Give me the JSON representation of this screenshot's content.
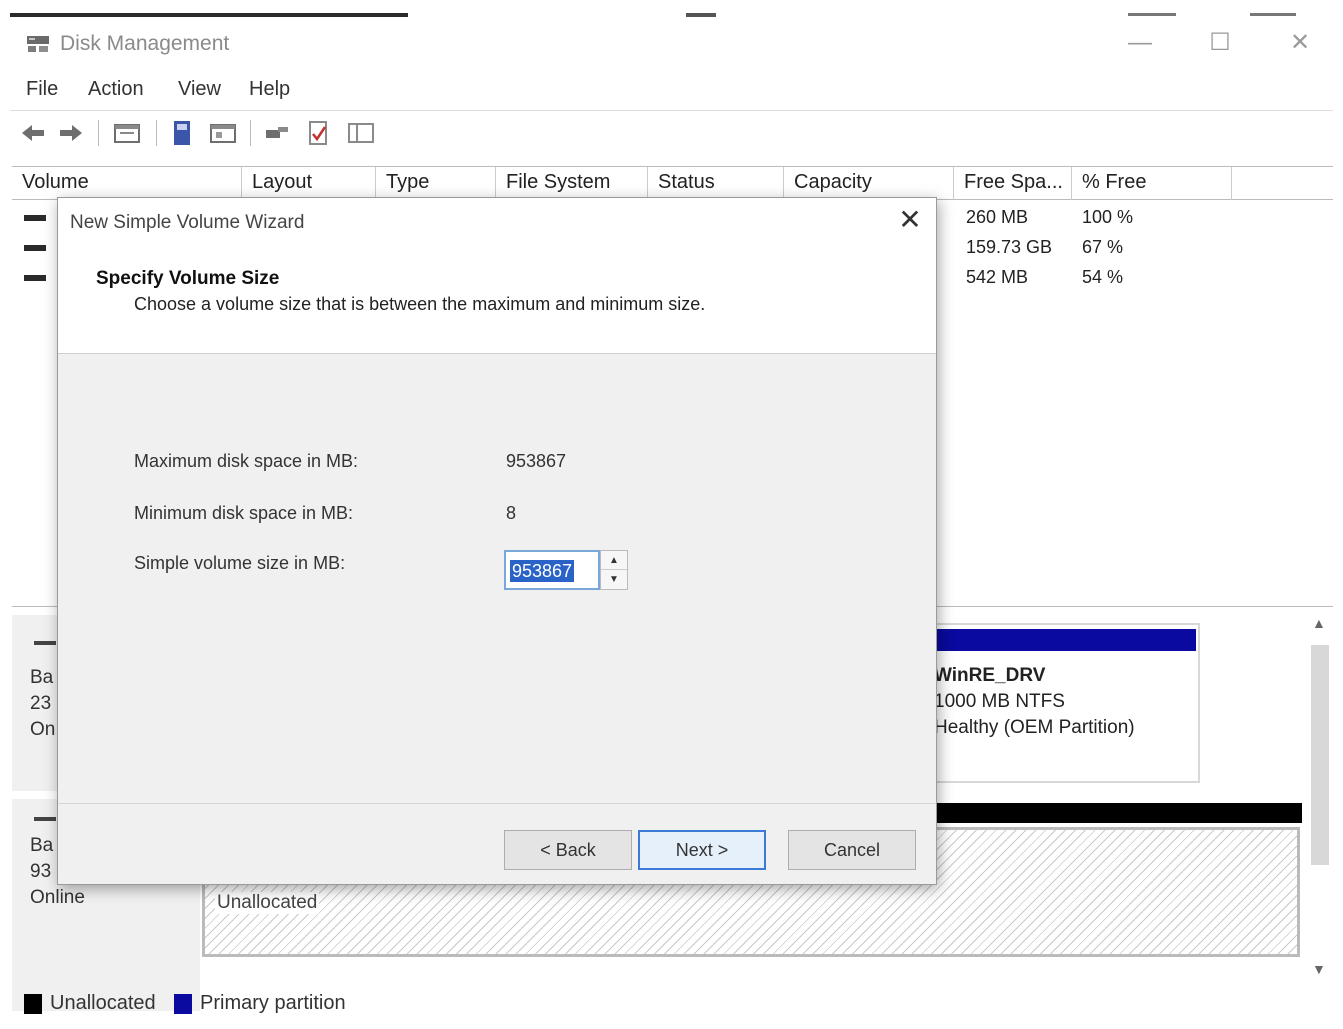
{
  "window": {
    "title": "Disk Management",
    "minimize_glyph": "—",
    "maximize_glyph": "☐",
    "close_glyph": "✕"
  },
  "menu": [
    "File",
    "Action",
    "View",
    "Help"
  ],
  "toolbar": {
    "icons": [
      "back-arrow-icon",
      "forward-arrow-icon",
      "console-tree-icon",
      "help-icon",
      "properties-icon",
      "connect-icon",
      "check-icon",
      "details-pane-icon"
    ]
  },
  "volume_list": {
    "columns": [
      "Volume",
      "Layout",
      "Type",
      "File System",
      "Status",
      "Capacity",
      "Free Spa...",
      "% Free"
    ],
    "rows": [
      {
        "free_space": "260 MB",
        "percent_free": "100 %"
      },
      {
        "free_space": "159.73 GB",
        "percent_free": "67 %"
      },
      {
        "free_space": "542 MB",
        "percent_free": "54 %"
      }
    ]
  },
  "disks": {
    "disk0": {
      "line1": "Ba",
      "line2": "23",
      "line3": "On"
    },
    "disk1": {
      "line1": "Ba",
      "line2": "93",
      "line3": "Online"
    },
    "winre": {
      "name": "WinRE_DRV",
      "size_fs": "1000 MB NTFS",
      "status": "Healthy (OEM Partition)"
    },
    "unallocated_label": "Unallocated"
  },
  "legend": [
    {
      "label": "Unallocated",
      "color": "#000000"
    },
    {
      "label": "Primary partition",
      "color": "#0a0aa0"
    }
  ],
  "wizard": {
    "title": "New Simple Volume Wizard",
    "close_glyph": "✕",
    "heading": "Specify Volume Size",
    "subheading": "Choose a volume size that is between the maximum and minimum size.",
    "max_label": "Maximum disk space in MB:",
    "max_value": "953867",
    "min_label": "Minimum disk space in MB:",
    "min_value": "8",
    "size_label": "Simple volume size in MB:",
    "size_value": "953867",
    "back_button": "< Back",
    "next_button": "Next >",
    "cancel_button": "Cancel"
  }
}
